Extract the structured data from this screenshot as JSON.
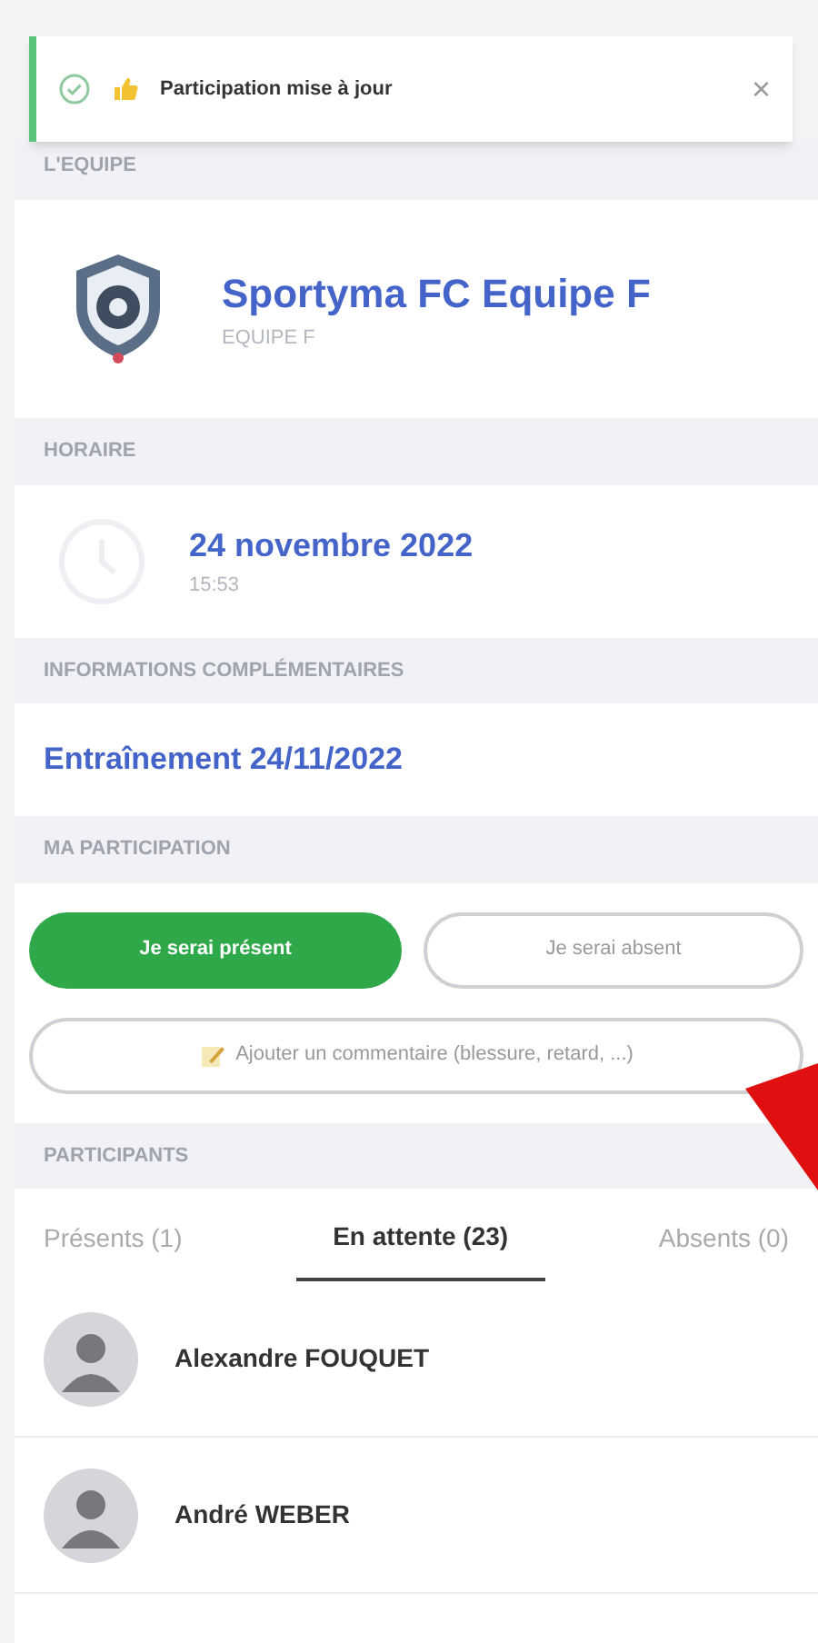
{
  "toast": {
    "message": "Participation mise à jour",
    "close": "×"
  },
  "team": {
    "header": "L'EQUIPE",
    "name": "Sportyma FC Equipe F",
    "subtitle": "EQUIPE F"
  },
  "schedule": {
    "header": "HORAIRE",
    "date": "24 novembre 2022",
    "time": "15:53"
  },
  "info": {
    "header": "INFORMATIONS COMPLÉMENTAIRES",
    "text": "Entraînement 24/11/2022"
  },
  "participation": {
    "header": "MA PARTICIPATION",
    "options": [
      {
        "label": "Je serai présent",
        "selected": true
      },
      {
        "label": "Je serai absent",
        "selected": false
      }
    ],
    "comment": "Ajouter un commentaire (blessure, retard, ...)"
  },
  "participants": {
    "header": "PARTICIPANTS",
    "tabs": [
      {
        "label": "Présents (1)",
        "selected": false
      },
      {
        "label": "En attente (23)",
        "selected": true
      },
      {
        "label": "Absents (0)",
        "selected": false
      }
    ],
    "people": [
      {
        "name": "Alexandre FOUQUET"
      },
      {
        "name": "André WEBER"
      }
    ]
  }
}
